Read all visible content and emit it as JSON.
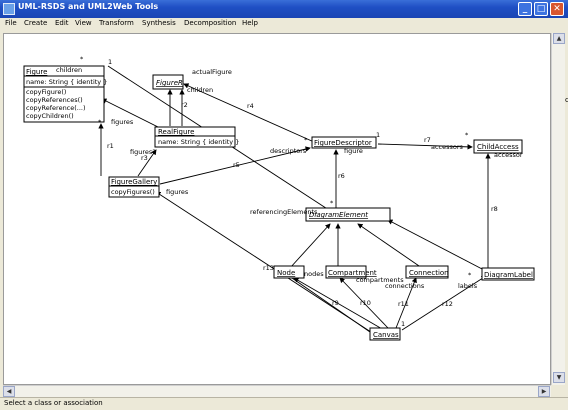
{
  "window": {
    "title": "UML-RSDS and UML2Web Tools",
    "controls": {
      "minimize": "_",
      "maximize": "□",
      "close": "✕"
    }
  },
  "menu": [
    {
      "label": "File"
    },
    {
      "label": "Create"
    },
    {
      "label": "Edit"
    },
    {
      "label": "View"
    },
    {
      "label": "Transform"
    },
    {
      "label": "Synthesis"
    },
    {
      "label": "Decomposition"
    },
    {
      "label": "Help"
    }
  ],
  "status": "Select a class or association",
  "right_edge_fragment": "c",
  "diagram": {
    "classes": {
      "figure": {
        "name": "Figure",
        "attrs": [
          "name: String { identity }"
        ],
        "ops": [
          "copyFigure()",
          "copyReferences()",
          "copyReference(...)",
          "copyChildren()"
        ]
      },
      "figure_r": {
        "name": "FigureR"
      },
      "real_figure": {
        "name": "RealFigure",
        "attrs": [
          "name: String { identity }"
        ]
      },
      "figure_gallery": {
        "name": "FigureGallery",
        "ops": [
          "copyFigures()"
        ]
      },
      "figure_descriptor": {
        "name": "FigureDescriptor"
      },
      "child_access": {
        "name": "ChildAccess"
      },
      "diagram_element": {
        "name": "DiagramElement"
      },
      "node": {
        "name": "Node"
      },
      "compartment": {
        "name": "Compartment"
      },
      "connection": {
        "name": "Connection"
      },
      "diagram_label": {
        "name": "DiagramLabel"
      },
      "canvas": {
        "name": "Canvas"
      }
    },
    "labels": {
      "children_a": "children",
      "star_a": "*",
      "star_b": "*",
      "one_a": "1",
      "actual_figure": "actualFigure",
      "children_b": "children",
      "r2": "r2",
      "r4": "r4",
      "r1": "r1",
      "figures_a": "figures",
      "figures_b": "figures?",
      "r3": "r3",
      "figures_c": "figures",
      "r5": "r5",
      "descriptors": "descriptors",
      "star_c": "*",
      "one_b": "1",
      "r7": "r7",
      "accessors": "accessors",
      "star_d": "*",
      "accessor": "accessor",
      "r6": "r6",
      "figure_lbl": "figure",
      "referencing": "referencingElements",
      "star_e": "*",
      "r8": "r8",
      "r13": "r13",
      "nodes": "nodes",
      "compartments": "compartments",
      "connections": "connections",
      "labels_lbl": "labels",
      "r9": "r9",
      "r10": "r10",
      "r11": "r11",
      "r12": "r12",
      "star_f": "*",
      "one_c": "1"
    }
  }
}
